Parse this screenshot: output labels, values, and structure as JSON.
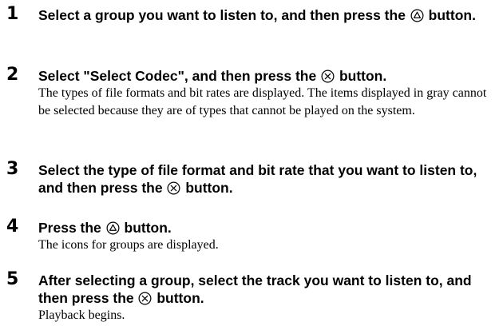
{
  "steps": [
    {
      "number": "1",
      "heading_before": "Select a group you want to listen to, and then press the ",
      "heading_icon": "triangle-button-icon",
      "heading_after": " button."
    },
    {
      "number": "2",
      "heading_before": "Select \"Select Codec\", and then press the ",
      "heading_icon": "cross-button-icon",
      "heading_after": " button.",
      "body": "The types of file formats and bit rates are displayed. The items displayed in gray cannot be selected because they are of types that cannot be played on the system."
    },
    {
      "number": "3",
      "heading_before": "Select the type of file format and bit rate that you want to listen to, and then press the ",
      "heading_icon": "cross-button-icon",
      "heading_after": " button."
    },
    {
      "number": "4",
      "heading_before": "Press the ",
      "heading_icon": "triangle-button-icon",
      "heading_after": " button.",
      "body": "The icons for groups are displayed."
    },
    {
      "number": "5",
      "heading_before": "After selecting a group, select the track you want to listen to, and then press the ",
      "heading_icon": "cross-button-icon",
      "heading_after": " button.",
      "body": "Playback begins."
    }
  ]
}
